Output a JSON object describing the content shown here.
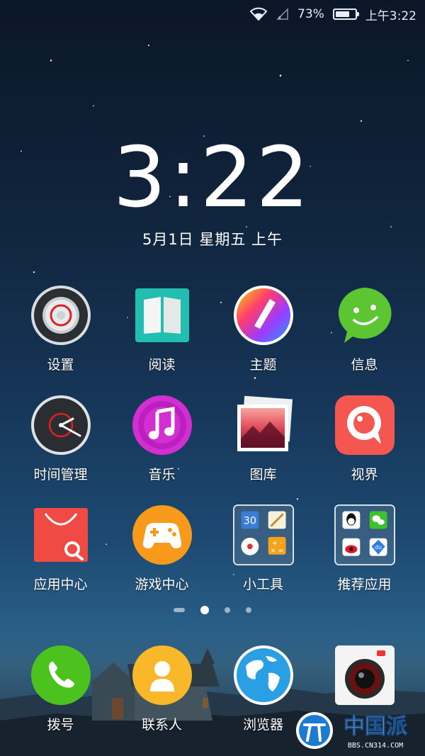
{
  "status_bar": {
    "battery_percent_text": "73%",
    "battery_level": 0.73,
    "time": "上午3:22"
  },
  "clock": {
    "time": "3:22",
    "date": "5月1日 星期五 上午"
  },
  "apps": [
    {
      "label": "设置",
      "icon": "settings-icon"
    },
    {
      "label": "阅读",
      "icon": "reader-icon"
    },
    {
      "label": "主题",
      "icon": "theme-icon"
    },
    {
      "label": "信息",
      "icon": "messages-icon"
    },
    {
      "label": "时间管理",
      "icon": "clock-icon"
    },
    {
      "label": "音乐",
      "icon": "music-icon"
    },
    {
      "label": "图库",
      "icon": "gallery-icon"
    },
    {
      "label": "视界",
      "icon": "video-icon"
    },
    {
      "label": "应用中心",
      "icon": "app-store-icon"
    },
    {
      "label": "游戏中心",
      "icon": "game-center-icon"
    },
    {
      "label": "小工具",
      "icon": "tools-folder-icon"
    },
    {
      "label": "推荐应用",
      "icon": "recommended-folder-icon"
    }
  ],
  "tools_folder": {
    "calendar_day": "30"
  },
  "page_indicator": {
    "pages": 4,
    "current": 2
  },
  "dock": [
    {
      "label": "拨号",
      "icon": "phone-icon"
    },
    {
      "label": "联系人",
      "icon": "contacts-icon"
    },
    {
      "label": "浏览器",
      "icon": "browser-icon"
    },
    {
      "label": "",
      "icon": "camera-icon"
    }
  ],
  "watermark": {
    "logo_text": "中国派",
    "url": "BBS.CN314.COM"
  },
  "colors": {
    "messages_green": "#5cc531",
    "video_red": "#f3574f",
    "appstore_red": "#f04a45",
    "game_orange": "#f79a1b",
    "music_magenta": "#d12fd0",
    "reader_teal": "#22bfb0",
    "phone_green": "#4cc21f",
    "contacts_yellow": "#f9b72a",
    "browser_blue": "#2a9fe3"
  }
}
